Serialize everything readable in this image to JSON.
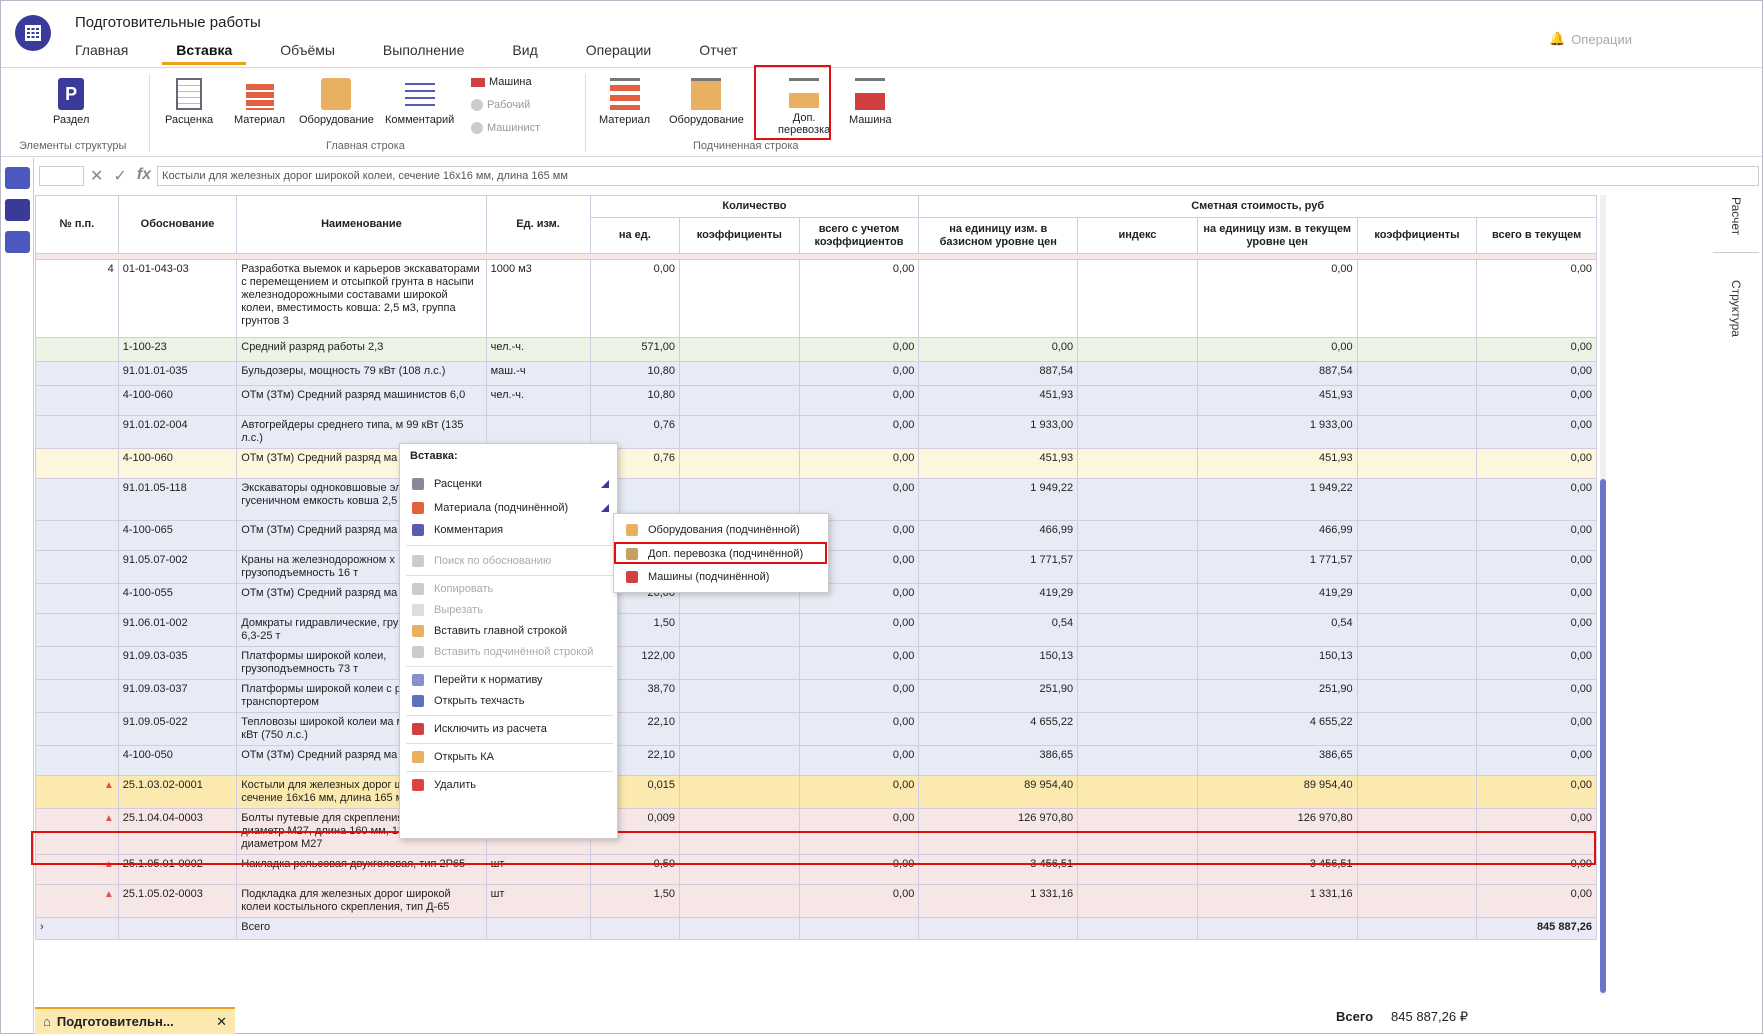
{
  "app": {
    "title": "Подготовительные работы",
    "operations": "Операции"
  },
  "tabs": [
    "Главная",
    "Вставка",
    "Объёмы",
    "Выполнение",
    "Вид",
    "Операции",
    "Отчет"
  ],
  "ribbon": {
    "structure": {
      "razdel": "Раздел",
      "group": "Элементы структуры"
    },
    "main": {
      "rascenka": "Расценка",
      "material": "Материал",
      "equipment": "Оборудование",
      "comment": "Комментарий",
      "machine": "Машина",
      "worker": "Рабочий",
      "machinist": "Машинист",
      "group": "Главная строка"
    },
    "sub": {
      "material": "Материал",
      "equipment": "Оборудование",
      "transport1": "Доп.",
      "transport2": "перевозка",
      "machine": "Машина",
      "group": "Подчиненная строка"
    }
  },
  "formula": {
    "fx": "fx",
    "value": "Костыли для железных дорог широкой колеи, сечение 16х16 мм, длина 165 мм"
  },
  "headers": {
    "num": "№ п.п.",
    "basis": "Обоснование",
    "name": "Наименование",
    "unit": "Ед. изм.",
    "qty": "Количество",
    "cost": "Сметная стоимость, руб",
    "per_unit": "на ед.",
    "coef": "коэффициенты",
    "total_coef": "всего с учетом коэффициентов",
    "base_price": "на единицу изм. в базисном уровне цен",
    "index": "индекс",
    "cur_price": "на единицу изм. в текущем уровне цен",
    "coef2": "коэффициенты",
    "total_cur": "всего в текущем"
  },
  "rows": [
    {
      "n": "4",
      "basis": "01-01-043-03",
      "name": "Разработка выемок и карьеров экскаваторами с перемещением и отсыпкой грунта в насыпи железнодорожными составами широкой колеи, вместимость ковша: 2,5 м3, группа грунтов 3",
      "unit": "1000 м3",
      "qty": "0,00",
      "tcoef": "0,00",
      "base": "",
      "cur": "0,00",
      "total": "0,00",
      "cls": "r-white"
    },
    {
      "n": "",
      "basis": "1-100-23",
      "name": "Средний разряд работы 2,3",
      "unit": "чел.-ч.",
      "qty": "571,00",
      "tcoef": "0,00",
      "base": "0,00",
      "cur": "0,00",
      "total": "0,00",
      "cls": "r-green"
    },
    {
      "n": "",
      "basis": "91.01.01-035",
      "name": "Бульдозеры, мощность 79 кВт (108 л.с.)",
      "unit": "маш.-ч",
      "qty": "10,80",
      "tcoef": "0,00",
      "base": "887,54",
      "cur": "887,54",
      "total": "0,00",
      "cls": "r-blue"
    },
    {
      "n": "",
      "basis": "4-100-060",
      "name": "ОТм (ЗТм) Средний разряд машинистов 6,0",
      "unit": "чел.-ч.",
      "qty": "10,80",
      "tcoef": "0,00",
      "base": "451,93",
      "cur": "451,93",
      "total": "0,00",
      "cls": "r-blue"
    },
    {
      "n": "",
      "basis": "91.01.02-004",
      "name": "Автогрейдеры среднего типа, м 99 кВт (135 л.с.)",
      "unit": "",
      "qty": "0,76",
      "tcoef": "0,00",
      "base": "1 933,00",
      "cur": "1 933,00",
      "total": "0,00",
      "cls": "r-blue"
    },
    {
      "n": "",
      "basis": "4-100-060",
      "name": "ОТм (ЗТм) Средний разряд ма 6,0",
      "unit": "",
      "qty": "0,76",
      "tcoef": "0,00",
      "base": "451,93",
      "cur": "451,93",
      "total": "0,00",
      "cls": "r-yellow"
    },
    {
      "n": "",
      "basis": "91.01.05-118",
      "name": "Экскаваторы одноковшовые электрические на гусеничном емкость ковша 2,5 м3",
      "unit": "",
      "qty": "",
      "tcoef": "0,00",
      "base": "1 949,22",
      "cur": "1 949,22",
      "total": "0,00",
      "cls": "r-blue"
    },
    {
      "n": "",
      "basis": "4-100-065",
      "name": "ОТм (ЗТм) Средний разряд ма 6,5",
      "unit": "",
      "qty": "",
      "tcoef": "0,00",
      "base": "466,99",
      "cur": "466,99",
      "total": "0,00",
      "cls": "r-blue"
    },
    {
      "n": "",
      "basis": "91.05.07-002",
      "name": "Краны на железнодорожном х грузоподъемность 16 т",
      "unit": "",
      "qty": "10,00",
      "tcoef": "0,00",
      "base": "1 771,57",
      "cur": "1 771,57",
      "total": "0,00",
      "cls": "r-blue"
    },
    {
      "n": "",
      "basis": "4-100-055",
      "name": "ОТм (ЗТм) Средний разряд ма 5,5",
      "unit": "",
      "qty": "20,00",
      "tcoef": "0,00",
      "base": "419,29",
      "cur": "419,29",
      "total": "0,00",
      "cls": "r-blue"
    },
    {
      "n": "",
      "basis": "91.06.01-002",
      "name": "Домкраты гидравлические, грузоподъемность 6,3-25 т",
      "unit": "",
      "qty": "1,50",
      "tcoef": "0,00",
      "base": "0,54",
      "cur": "0,54",
      "total": "0,00",
      "cls": "r-blue"
    },
    {
      "n": "",
      "basis": "91.09.03-035",
      "name": "Платформы широкой колеи, грузоподъемность 73 т",
      "unit": "",
      "qty": "122,00",
      "tcoef": "0,00",
      "base": "150,13",
      "cur": "150,13",
      "total": "0,00",
      "cls": "r-blue"
    },
    {
      "n": "",
      "basis": "91.09.03-037",
      "name": "Платформы широкой колеи с р транспортером",
      "unit": "",
      "qty": "38,70",
      "tcoef": "0,00",
      "base": "251,90",
      "cur": "251,90",
      "total": "0,00",
      "cls": "r-blue"
    },
    {
      "n": "",
      "basis": "91.09.05-022",
      "name": "Тепловозы широкой колеи ма мощность 550 кВт (750 л.с.)",
      "unit": "",
      "qty": "22,10",
      "tcoef": "0,00",
      "base": "4 655,22",
      "cur": "4 655,22",
      "total": "0,00",
      "cls": "r-blue"
    },
    {
      "n": "",
      "basis": "4-100-050",
      "name": "ОТм (ЗТм) Средний разряд ма 5,0",
      "unit": "",
      "qty": "22,10",
      "tcoef": "0,00",
      "base": "386,65",
      "cur": "386,65",
      "total": "0,00",
      "cls": "r-blue"
    },
    {
      "n": "",
      "basis": "25.1.03.02-0001",
      "name": "Костыли для железных дорог широкой колеи, сечение 16х16 мм, длина 165 мм",
      "unit": "т",
      "qty": "0,015",
      "tcoef": "0,00",
      "base": "89 954,40",
      "cur": "89 954,40",
      "total": "0,00",
      "cls": "r-sel"
    },
    {
      "n": "",
      "basis": "25.1.04.04-0003",
      "name": "Болты путевые для скрепления рельсов, диаметр М27, длина 160 мм, 180 мм, с гайкой диаметром М27",
      "unit": "т",
      "qty": "0,009",
      "tcoef": "0,00",
      "base": "126 970,80",
      "cur": "126 970,80",
      "total": "0,00",
      "cls": "r-pink"
    },
    {
      "n": "",
      "basis": "25.1.05.01-0002",
      "name": "Накладка рельсовая двухголовая, тип 2Р65",
      "unit": "шт",
      "qty": "0,50",
      "tcoef": "0,00",
      "base": "3 456,51",
      "cur": "3 456,51",
      "total": "0,00",
      "cls": "r-pink"
    },
    {
      "n": "",
      "basis": "25.1.05.02-0003",
      "name": "Подкладка для железных дорог широкой колеи костыльного скрепления, тип Д-65",
      "unit": "шт",
      "qty": "1,50",
      "tcoef": "0,00",
      "base": "1 331,16",
      "cur": "1 331,16",
      "total": "0,00",
      "cls": "r-pink"
    }
  ],
  "total_row": {
    "label": "Всего",
    "value": "845 887,26"
  },
  "context_menu": {
    "header": "Вставка:",
    "items": [
      "Расценки",
      "Материала (подчинённой)",
      "Комментария",
      "Поиск по обоснованию",
      "Копировать",
      "Вырезать",
      "Вставить главной строкой",
      "Вставить подчинённой строкой",
      "Перейти к нормативу",
      "Открыть техчасть",
      "Исключить из расчета",
      "Открыть КА",
      "Удалить"
    ]
  },
  "submenu": [
    "Оборудования (подчинённой)",
    "Доп. перевозка (подчинённой)",
    "Машины (подчинённой)"
  ],
  "right_tabs": [
    "Расчет",
    "Структура"
  ],
  "bottom": {
    "tab": "Подготовительн...",
    "total_label": "Всего",
    "total_value": "845 887,26 ₽"
  },
  "colors": {
    "accent": "#f0a020",
    "highlight": "#e01010",
    "brand": "#3a3a9a"
  }
}
